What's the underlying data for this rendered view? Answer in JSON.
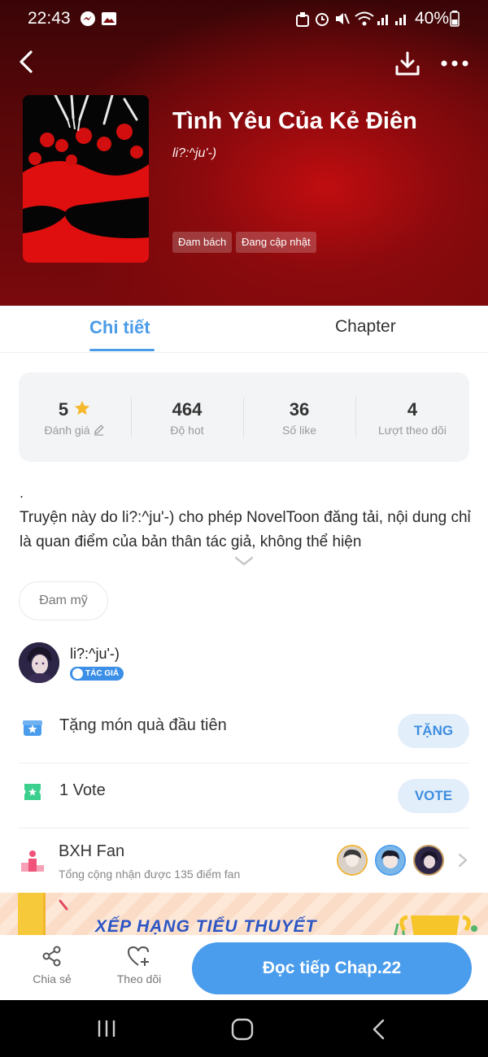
{
  "status_bar": {
    "time": "22:43",
    "battery": "40%"
  },
  "book": {
    "title": "Tình Yêu Của Kẻ Điên",
    "author": "li?:^ju'-)",
    "tags": [
      "Đam bách",
      "Đang cập nhật"
    ]
  },
  "tabs": {
    "detail": "Chi tiết",
    "chapter": "Chapter"
  },
  "stats": [
    {
      "value": "5",
      "label": "Đánh giá"
    },
    {
      "value": "464",
      "label": "Độ hot"
    },
    {
      "value": "36",
      "label": "Số like"
    },
    {
      "value": "4",
      "label": "Lượt theo dõi"
    }
  ],
  "description": {
    "dot": ".",
    "text": "Truyện này do li?:^ju'-) cho phép NovelToon đăng tải, nội dung chỉ là quan điểm của bản thân tác giả, không thể hiện"
  },
  "genre": "Đam mỹ",
  "author_card": {
    "name": "li?:^ju'-)",
    "badge": "TÁC GIẢ"
  },
  "gift_row": {
    "text": "Tặng món quà đầu tiên",
    "button": "TẶNG"
  },
  "vote_row": {
    "text": "1 Vote",
    "button": "VOTE"
  },
  "fan_row": {
    "title": "BXH Fan",
    "subtitle": "Tổng cộng nhận được 135 điểm fan"
  },
  "banner": {
    "text": "XẾP HẠNG TIỂU THUYẾT"
  },
  "bottom_bar": {
    "share": "Chia sẻ",
    "follow": "Theo dõi",
    "read": "Đọc tiếp Chap.22"
  },
  "colors": {
    "accent": "#4a9cec",
    "hero_red": "#8c0a0d",
    "star": "#f5b82e"
  },
  "icons": [
    "back-icon",
    "download-icon",
    "more-icon",
    "star-icon",
    "edit-icon",
    "chevron-down-icon",
    "gift-icon",
    "vote-ticket-icon",
    "podium-icon",
    "chevron-right-icon",
    "share-icon",
    "heart-plus-icon"
  ]
}
